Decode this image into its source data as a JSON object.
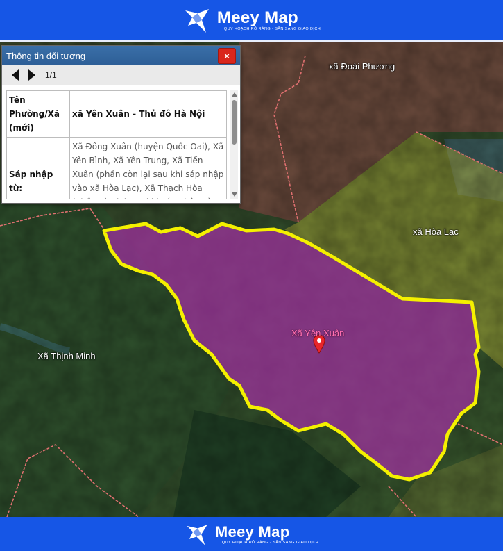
{
  "brand": {
    "name": "Meey Map",
    "tagline": "QUY HOẠCH RÕ RÀNG - SẴN SÀNG GIAO DỊCH"
  },
  "panel": {
    "title": "Thông tin đối tượng",
    "close_label": "×",
    "page_indicator": "1/1",
    "rows": [
      {
        "key": "Tên Phường/Xã (mới)",
        "value": "xã Yên Xuân - Thủ đô Hà Nội"
      },
      {
        "key": "Sáp nhập từ:",
        "value": "Xã Đông Xuân (huyện Quốc Oai), Xã Yên Bình, Xã Yên Trung, Xã Tiến Xuân (phần còn lại sau khi sáp nhập vào xã Hòa Lạc), Xã Thạch Hòa (phần còn lại sau khi sáp nhập vào xã Yên"
      }
    ]
  },
  "map": {
    "labels": {
      "doai_phuong": "xã Đoài Phương",
      "hoa_lac": "xã Hòa Lạc",
      "yen_xuan": "Xã Yên Xuân",
      "thinh_minh": "Xã Thịnh Minh"
    },
    "colors": {
      "highlight_fill": "#b02fb0",
      "highlight_border": "#f4f000",
      "neighbor_fill": "#c8c23a",
      "boundary": "#e07070",
      "marker": "#e8262a"
    },
    "icons": [
      "location-pin-icon",
      "meey-logo-icon",
      "close-icon",
      "arrow-left-icon",
      "arrow-right-icon"
    ]
  }
}
